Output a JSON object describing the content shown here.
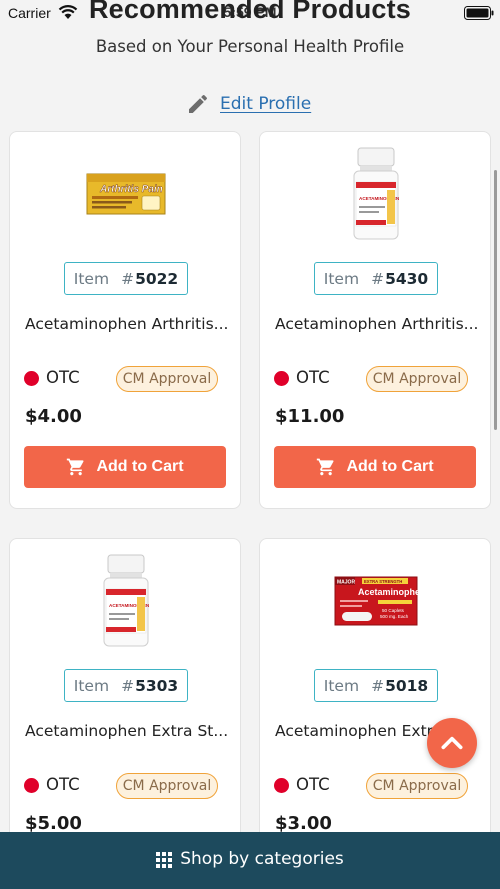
{
  "status_bar": {
    "carrier": "Carrier",
    "time": "5:59 PM"
  },
  "header": {
    "title": "Recommended Products",
    "subtitle": "Based on Your Personal Health Profile",
    "edit_profile_label": "Edit Profile"
  },
  "item_prefix": "Item",
  "item_hash": "#",
  "otc_label": "OTC",
  "approval_label": "CM Approval",
  "add_to_cart_label": "Add to Cart",
  "products": [
    {
      "item_number": "5022",
      "name": "Acetaminophen Arthritis...",
      "price": "$4.00",
      "image": "arthritis-pain-box"
    },
    {
      "item_number": "5430",
      "name": "Acetaminophen Arthritis...",
      "price": "$11.00",
      "image": "acetaminophen-bottle"
    },
    {
      "item_number": "5303",
      "name": "Acetaminophen Extra St...",
      "price": "$5.00",
      "image": "acetaminophen-bottle"
    },
    {
      "item_number": "5018",
      "name": "Acetaminophen Extr...",
      "price": "$3.00",
      "image": "acetaminophen-red-box"
    }
  ],
  "box_labels": {
    "arthritis_brand": "Arthritis Pain",
    "bottle_name": "ACETAMINOPHEN",
    "red_box_brand": "MAJOR",
    "red_box_strength": "EXTRA STRENGTH",
    "red_box_name": "Acetaminophen",
    "red_box_count": "50 Caplets",
    "red_box_dose": "500 mg. Each"
  },
  "bottom_bar": {
    "label": "Shop by categories"
  },
  "colors": {
    "accent": "#f26649",
    "bottom_bar": "#1d4a5d",
    "badge_border": "#3eb3c4",
    "otc_dot": "#e0002a",
    "approval_border": "#f0a33a",
    "link": "#2a6fb0"
  }
}
